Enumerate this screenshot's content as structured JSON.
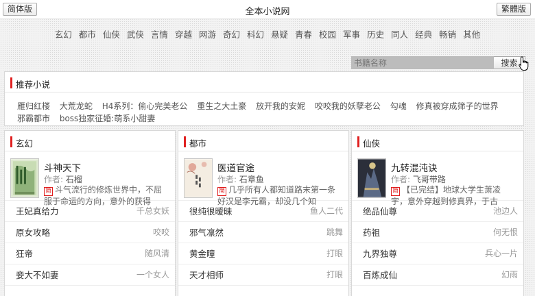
{
  "header": {
    "simplified_label": "简体版",
    "traditional_label": "繁體版",
    "site_title": "全本小说网"
  },
  "nav": [
    "玄幻",
    "都市",
    "仙侠",
    "武侠",
    "言情",
    "穿越",
    "网游",
    "奇幻",
    "科幻",
    "悬疑",
    "青春",
    "校园",
    "军事",
    "历史",
    "同人",
    "经典",
    "畅销",
    "其他"
  ],
  "search": {
    "placeholder": "书籍名称",
    "button_label": "搜索"
  },
  "recommend": {
    "title": "推荐小说",
    "links": [
      "雁归红楼",
      "大荒龙蛇",
      "H4系列：偷心完美老公",
      "重生之大土豪",
      "放开我的安妮",
      "咬咬我的妖孽老公",
      "勾魂",
      "修真被穿成筛子的世界",
      "邪霸都市",
      "boss独家征婚:萌系小甜妻"
    ]
  },
  "tag_label": "简",
  "columns": [
    {
      "title": "玄幻",
      "feature": {
        "name": "斗神天下",
        "author_label": "作者:",
        "author": "石榴",
        "desc": "斗气流行的修炼世界中，不屈服于命运的方向，意外的获得"
      },
      "rows": [
        {
          "name": "王妃真给力",
          "author": "千总女妖"
        },
        {
          "name": "原女攻略",
          "author": "咬咬"
        },
        {
          "name": "狂帝",
          "author": "随风清"
        },
        {
          "name": "妾大不如妻",
          "author": "一个女人"
        }
      ]
    },
    {
      "title": "都市",
      "feature": {
        "name": "医道官途",
        "author_label": "作者:",
        "author": "石章鱼",
        "desc": "几乎所有人都知道路末第一条好汉是李元霸，却没几个知"
      },
      "rows": [
        {
          "name": "很纯很暧昧",
          "author": "鱼人二代"
        },
        {
          "name": "邪气凛然",
          "author": "跳舞"
        },
        {
          "name": "黄金瞳",
          "author": "打眼"
        },
        {
          "name": "天才相师",
          "author": "打眼"
        }
      ]
    },
    {
      "title": "仙侠",
      "feature": {
        "name": "九转混沌诀",
        "author_label": "作者:",
        "author": "飞哥带路",
        "desc": "【已完结】地球大学生萧凌宇，意外穿越到修真界，于古"
      },
      "rows": [
        {
          "name": "绝品仙尊",
          "author": "池边人"
        },
        {
          "name": "药祖",
          "author": "何无恨"
        },
        {
          "name": "九界独尊",
          "author": "兵心一片"
        },
        {
          "name": "百炼成仙",
          "author": "幻雨"
        }
      ]
    }
  ]
}
